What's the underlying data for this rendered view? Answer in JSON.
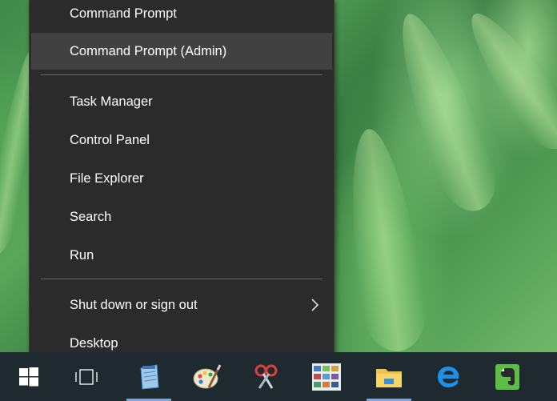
{
  "menu": {
    "items": [
      {
        "label": "Command Prompt"
      },
      {
        "label": "Command Prompt (Admin)"
      },
      {
        "label": "Task Manager"
      },
      {
        "label": "Control Panel"
      },
      {
        "label": "File Explorer"
      },
      {
        "label": "Search"
      },
      {
        "label": "Run"
      },
      {
        "label": "Shut down or sign out"
      },
      {
        "label": "Desktop"
      }
    ],
    "hovered_item": "Command Prompt (Admin)"
  },
  "taskbar": {
    "icons": [
      "windows-start-icon",
      "task-view-icon",
      "notepad-app-icon",
      "paint-app-icon",
      "snipping-tool-icon",
      "photo-collage-app-icon",
      "file-explorer-icon",
      "edge-browser-icon",
      "evernote-icon"
    ]
  },
  "colors": {
    "menu_bg": "#2b2b2b",
    "menu_hover": "#414141",
    "taskbar_bg": "#1e2a30",
    "active_underline": "#7ea6d8",
    "edge_blue": "#1e90e8",
    "evernote_green": "#5cbd47"
  }
}
